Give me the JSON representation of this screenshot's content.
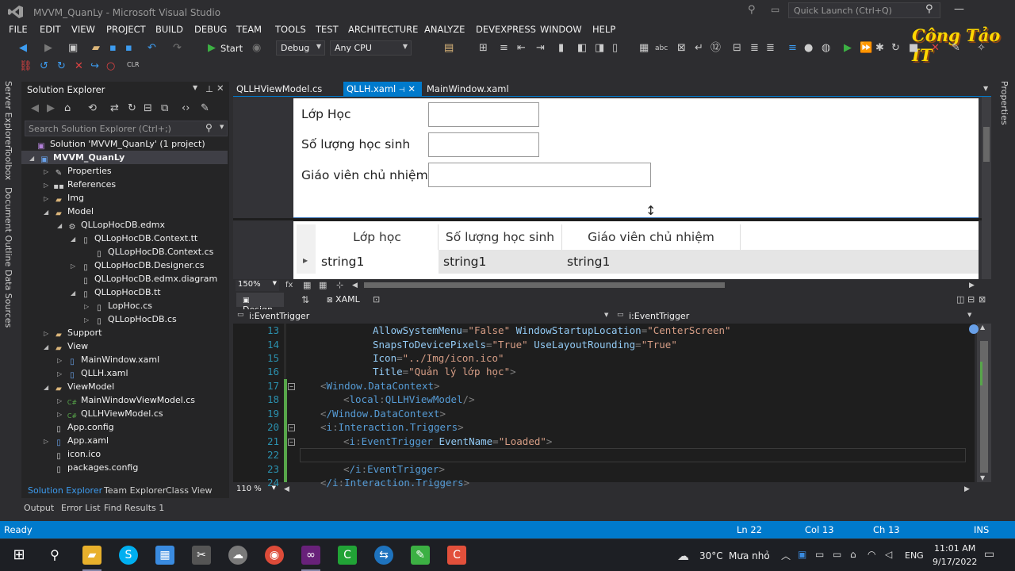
{
  "window": {
    "title": "MVVM_QuanLy - Microsoft Visual Studio",
    "quick_launch": "Quick Launch (Ctrl+Q)"
  },
  "menu": [
    "FILE",
    "EDIT",
    "VIEW",
    "PROJECT",
    "BUILD",
    "DEBUG",
    "TEAM",
    "TOOLS",
    "TEST",
    "ARCHITECTURE",
    "ANALYZE",
    "DEVEXPRESS",
    "WINDOW",
    "HELP"
  ],
  "toolbar": {
    "start": "Start",
    "config": "Debug",
    "platform": "Any CPU"
  },
  "watermark": "Công Tảo IT",
  "left_strip": [
    "Server Explorer",
    "Toolbox",
    "Document Outline",
    "Data Sources"
  ],
  "right_strip": [
    "Properties"
  ],
  "solution_explorer": {
    "title": "Solution Explorer",
    "search": "Search Solution Explorer (Ctrl+;)",
    "items": [
      {
        "label": "Solution 'MVVM_QuanLy' (1 project)",
        "icon": "solution-icon"
      },
      {
        "label": "MVVM_QuanLy",
        "icon": "project-icon"
      },
      {
        "label": "Properties",
        "icon": "wrench-icon"
      },
      {
        "label": "References",
        "icon": "references-icon"
      },
      {
        "label": "Img",
        "icon": "folder-icon"
      },
      {
        "label": "Model",
        "icon": "folder-icon"
      },
      {
        "label": "QLLopHocDB.edmx",
        "icon": "edmx-icon"
      },
      {
        "label": "QLLopHocDB.Context.tt",
        "icon": "tt-icon"
      },
      {
        "label": "QLLopHocDB.Context.cs",
        "icon": "cs-file-icon"
      },
      {
        "label": "QLLopHocDB.Designer.cs",
        "icon": "cs-file-icon"
      },
      {
        "label": "QLLopHocDB.edmx.diagram",
        "icon": "file-icon"
      },
      {
        "label": "QLLopHocDB.tt",
        "icon": "tt-icon"
      },
      {
        "label": "LopHoc.cs",
        "icon": "cs-file-icon"
      },
      {
        "label": "QLLopHocDB.cs",
        "icon": "cs-file-icon"
      },
      {
        "label": "Support",
        "icon": "folder-icon"
      },
      {
        "label": "View",
        "icon": "folder-icon"
      },
      {
        "label": "MainWindow.xaml",
        "icon": "xaml-icon"
      },
      {
        "label": "QLLH.xaml",
        "icon": "xaml-icon"
      },
      {
        "label": "ViewModel",
        "icon": "folder-icon"
      },
      {
        "label": "MainWindowViewModel.cs",
        "icon": "cs-class-icon"
      },
      {
        "label": "QLLHViewModel.cs",
        "icon": "cs-class-icon"
      },
      {
        "label": "App.config",
        "icon": "config-icon"
      },
      {
        "label": "App.xaml",
        "icon": "xaml-icon"
      },
      {
        "label": "icon.ico",
        "icon": "ico-icon"
      },
      {
        "label": "packages.config",
        "icon": "config-icon"
      }
    ],
    "tabs": [
      "Solution Explorer",
      "Team Explorer",
      "Class View"
    ]
  },
  "bottom_tabs": [
    "Output",
    "Error List",
    "Find Results 1"
  ],
  "doc_tabs": [
    {
      "label": "QLLHViewModel.cs"
    },
    {
      "label": "QLLH.xaml",
      "active": true
    },
    {
      "label": "MainWindow.xaml"
    }
  ],
  "designer": {
    "labels": [
      "Lớp Học",
      "Số lượng học sinh",
      "Giáo viên chủ nhiệm"
    ],
    "grid_headers": [
      "Lớp học",
      "Số lượng học sinh",
      "Giáo viên chủ nhiệm"
    ],
    "grid_row": [
      "string1",
      "string1",
      "string1"
    ],
    "zoom": "150%",
    "design_tab": "Design",
    "xaml_tab": "XAML"
  },
  "nav": {
    "left": "i:EventTrigger",
    "right": "i:EventTrigger"
  },
  "code": {
    "zoom": "110 %",
    "lines": [
      {
        "n": "13"
      },
      {
        "n": "14"
      },
      {
        "n": "15"
      },
      {
        "n": "16"
      },
      {
        "n": "17"
      },
      {
        "n": "18"
      },
      {
        "n": "19"
      },
      {
        "n": "20"
      },
      {
        "n": "21"
      },
      {
        "n": "22"
      },
      {
        "n": "23"
      },
      {
        "n": "24"
      }
    ],
    "frag": {
      "l13a": "AllowSystemMenu",
      "l13b": "\"False\"",
      "l13c": "WindowStartupLocation",
      "l13d": "\"CenterScreen\"",
      "l14a": "SnapsToDevicePixels",
      "l14b": "\"True\"",
      "l14c": "UseLayoutRounding",
      "l14d": "\"True\"",
      "l15a": "Icon",
      "l15b": "\"../Img/icon.ico\"",
      "l16a": "Title",
      "l16b": "\"Quản lý lớp học\"",
      "l17": "Window.DataContext",
      "l18a": "local",
      "l18b": "QLLHViewModel",
      "l19": "/Window.DataContext",
      "l20a": "i",
      "l20b": "Interaction.Triggers",
      "l21a": "i",
      "l21b": "EventTrigger",
      "l21c": "EventName",
      "l21d": "\"Loaded\"",
      "l23a": "/i",
      "l23b": "EventTrigger",
      "l24a": "/i",
      "l24b": "Interaction.Triggers"
    }
  },
  "status": {
    "ready": "Ready",
    "ln": "Ln 22",
    "col": "Col 13",
    "ch": "Ch 13",
    "mode": "INS"
  },
  "taskbar": {
    "weather": "30°C",
    "weather_desc": "Mưa nhỏ",
    "lang": "ENG",
    "time": "11:01 AM",
    "date": "9/17/2022"
  }
}
